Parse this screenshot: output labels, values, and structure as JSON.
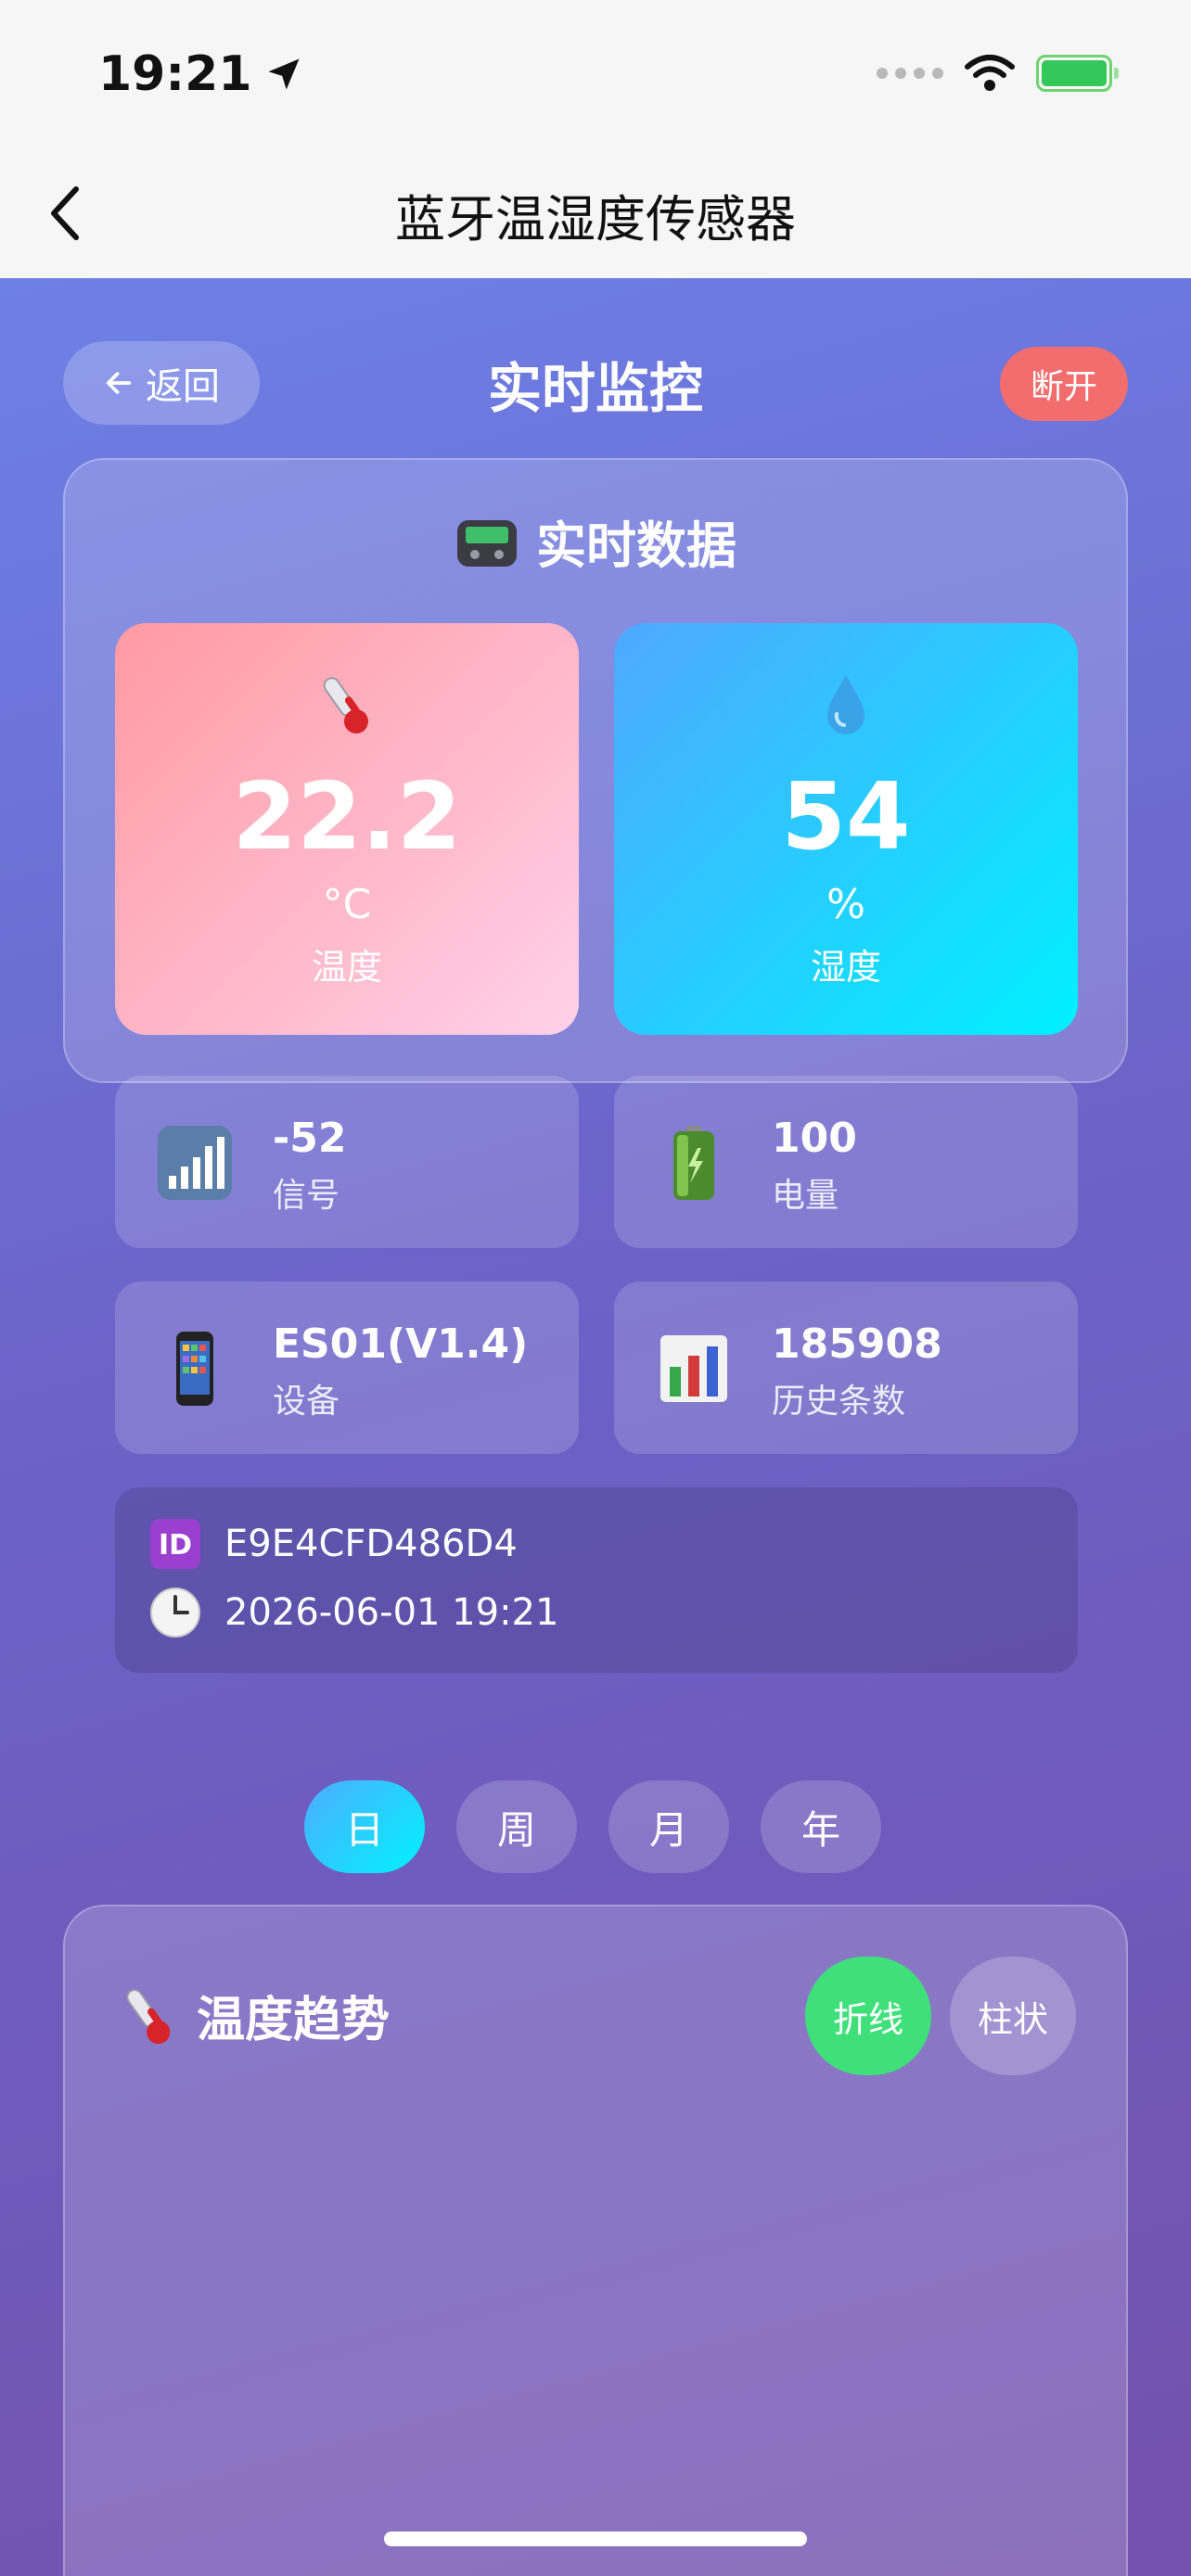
{
  "status_bar": {
    "time": "19:21"
  },
  "nav": {
    "title": "蓝牙温湿度传感器"
  },
  "header": {
    "back_label": "返回",
    "title": "实时监控",
    "disconnect_label": "断开"
  },
  "realtime": {
    "title": "实时数据",
    "temperature": {
      "value": "22.2",
      "unit": "°C",
      "label": "温度"
    },
    "humidity": {
      "value": "54",
      "unit": "%",
      "label": "湿度"
    },
    "signal": {
      "value": "-52",
      "label": "信号"
    },
    "battery": {
      "value": "100",
      "label": "电量"
    },
    "device": {
      "value": "ES01(V1.4)",
      "label": "设备"
    },
    "history": {
      "value": "185908",
      "label": "历史条数"
    },
    "device_id": "E9E4CFD486D4",
    "timestamp": "2026-06-01 19:21"
  },
  "period_tabs": [
    {
      "label": "日",
      "active": true
    },
    {
      "label": "周",
      "active": false
    },
    {
      "label": "月",
      "active": false
    },
    {
      "label": "年",
      "active": false
    }
  ],
  "trend": {
    "title": "温度趋势",
    "line_label": "折线",
    "bar_label": "柱状"
  },
  "colors": {
    "accent_green": "#3fe07a",
    "disconnect_red": "#f26d6d",
    "temp_tile": "#ff9aa2",
    "humidity_tile": "#4fa8ff"
  }
}
